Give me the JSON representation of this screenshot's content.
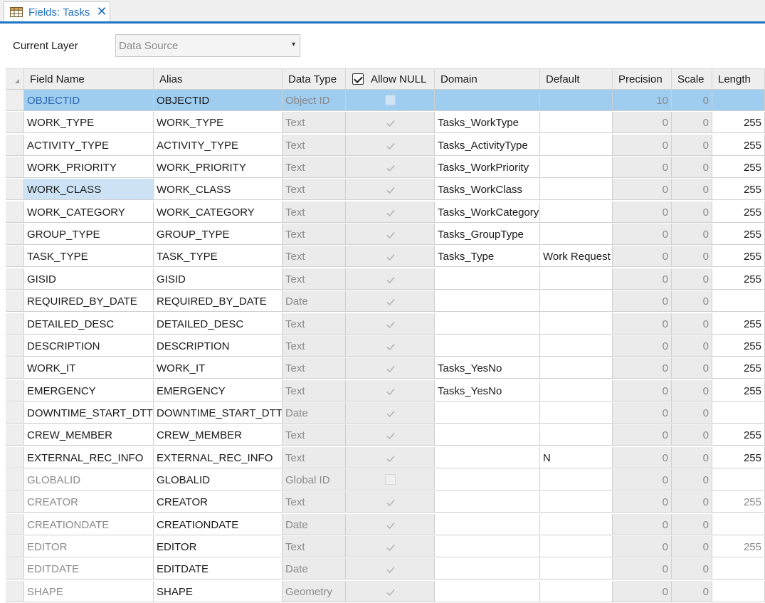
{
  "tab": {
    "title": "Fields: Tasks",
    "icon": "table-icon",
    "close_icon": "close-icon"
  },
  "layer": {
    "label": "Current Layer",
    "value": "Data Source",
    "arrow": "▾"
  },
  "columns": {
    "field_name": "Field Name",
    "alias": "Alias",
    "data_type": "Data Type",
    "allow_null": "Allow NULL",
    "domain": "Domain",
    "default": "Default",
    "precision": "Precision",
    "scale": "Scale",
    "length": "Length"
  },
  "rows": [
    {
      "field": "OBJECTID",
      "alias": "OBJECTID",
      "type": "Object ID",
      "null": "box",
      "domain": "",
      "default": "",
      "precision": "10",
      "scale": "0",
      "length": "",
      "field_style": "dim",
      "length_style": "norm"
    },
    {
      "field": "WORK_TYPE",
      "alias": "WORK_TYPE",
      "type": "Text",
      "null": "check",
      "domain": "Tasks_WorkType",
      "default": "",
      "precision": "0",
      "scale": "0",
      "length": "255",
      "field_style": "norm",
      "length_style": "norm"
    },
    {
      "field": "ACTIVITY_TYPE",
      "alias": "ACTIVITY_TYPE",
      "type": "Text",
      "null": "check",
      "domain": "Tasks_ActivityType",
      "default": "",
      "precision": "0",
      "scale": "0",
      "length": "255",
      "field_style": "norm",
      "length_style": "norm"
    },
    {
      "field": "WORK_PRIORITY",
      "alias": "WORK_PRIORITY",
      "type": "Text",
      "null": "check",
      "domain": "Tasks_WorkPriority",
      "default": "",
      "precision": "0",
      "scale": "0",
      "length": "255",
      "field_style": "norm",
      "length_style": "norm"
    },
    {
      "field": "WORK_CLASS",
      "alias": "WORK_CLASS",
      "type": "Text",
      "null": "check",
      "domain": "Tasks_WorkClass",
      "default": "",
      "precision": "0",
      "scale": "0",
      "length": "255",
      "field_style": "norm",
      "length_style": "norm"
    },
    {
      "field": "WORK_CATEGORY",
      "alias": "WORK_CATEGORY",
      "type": "Text",
      "null": "check",
      "domain": "Tasks_WorkCategory",
      "default": "",
      "precision": "0",
      "scale": "0",
      "length": "255",
      "field_style": "norm",
      "length_style": "norm"
    },
    {
      "field": "GROUP_TYPE",
      "alias": "GROUP_TYPE",
      "type": "Text",
      "null": "check",
      "domain": "Tasks_GroupType",
      "default": "",
      "precision": "0",
      "scale": "0",
      "length": "255",
      "field_style": "norm",
      "length_style": "norm"
    },
    {
      "field": "TASK_TYPE",
      "alias": "TASK_TYPE",
      "type": "Text",
      "null": "check",
      "domain": "Tasks_Type",
      "default": "Work Request",
      "precision": "0",
      "scale": "0",
      "length": "255",
      "field_style": "norm",
      "length_style": "norm"
    },
    {
      "field": "GISID",
      "alias": "GISID",
      "type": "Text",
      "null": "check",
      "domain": "",
      "default": "",
      "precision": "0",
      "scale": "0",
      "length": "255",
      "field_style": "norm",
      "length_style": "norm"
    },
    {
      "field": "REQUIRED_BY_DATE",
      "alias": "REQUIRED_BY_DATE",
      "type": "Date",
      "null": "check",
      "domain": "",
      "default": "",
      "precision": "0",
      "scale": "0",
      "length": "",
      "field_style": "norm",
      "length_style": "norm"
    },
    {
      "field": "DETAILED_DESC",
      "alias": "DETAILED_DESC",
      "type": "Text",
      "null": "check",
      "domain": "",
      "default": "",
      "precision": "0",
      "scale": "0",
      "length": "255",
      "field_style": "norm",
      "length_style": "norm"
    },
    {
      "field": "DESCRIPTION",
      "alias": "DESCRIPTION",
      "type": "Text",
      "null": "check",
      "domain": "",
      "default": "",
      "precision": "0",
      "scale": "0",
      "length": "255",
      "field_style": "norm",
      "length_style": "norm"
    },
    {
      "field": "WORK_IT",
      "alias": "WORK_IT",
      "type": "Text",
      "null": "check",
      "domain": "Tasks_YesNo",
      "default": "",
      "precision": "0",
      "scale": "0",
      "length": "255",
      "field_style": "norm",
      "length_style": "norm"
    },
    {
      "field": "EMERGENCY",
      "alias": "EMERGENCY",
      "type": "Text",
      "null": "check",
      "domain": "Tasks_YesNo",
      "default": "",
      "precision": "0",
      "scale": "0",
      "length": "255",
      "field_style": "norm",
      "length_style": "norm"
    },
    {
      "field": "DOWNTIME_START_DTTM",
      "alias": "DOWNTIME_START_DTTM",
      "type": "Date",
      "null": "check",
      "domain": "",
      "default": "",
      "precision": "0",
      "scale": "0",
      "length": "",
      "field_style": "norm",
      "length_style": "norm"
    },
    {
      "field": "CREW_MEMBER",
      "alias": "CREW_MEMBER",
      "type": "Text",
      "null": "check",
      "domain": "",
      "default": "",
      "precision": "0",
      "scale": "0",
      "length": "255",
      "field_style": "norm",
      "length_style": "norm"
    },
    {
      "field": "EXTERNAL_REC_INFO",
      "alias": "EXTERNAL_REC_INFO",
      "type": "Text",
      "null": "check",
      "domain": "",
      "default": "N",
      "precision": "0",
      "scale": "0",
      "length": "255",
      "field_style": "norm",
      "length_style": "norm"
    },
    {
      "field": "GLOBALID",
      "alias": "GLOBALID",
      "type": "Global ID",
      "null": "box",
      "domain": "",
      "default": "",
      "precision": "0",
      "scale": "0",
      "length": "",
      "field_style": "dim",
      "length_style": "norm"
    },
    {
      "field": "CREATOR",
      "alias": "CREATOR",
      "type": "Text",
      "null": "check",
      "domain": "",
      "default": "",
      "precision": "0",
      "scale": "0",
      "length": "255",
      "field_style": "dim",
      "length_style": "dim"
    },
    {
      "field": "CREATIONDATE",
      "alias": "CREATIONDATE",
      "type": "Date",
      "null": "check",
      "domain": "",
      "default": "",
      "precision": "0",
      "scale": "0",
      "length": "",
      "field_style": "dim",
      "length_style": "dim"
    },
    {
      "field": "EDITOR",
      "alias": "EDITOR",
      "type": "Text",
      "null": "check",
      "domain": "",
      "default": "",
      "precision": "0",
      "scale": "0",
      "length": "255",
      "field_style": "dim",
      "length_style": "dim"
    },
    {
      "field": "EDITDATE",
      "alias": "EDITDATE",
      "type": "Date",
      "null": "check",
      "domain": "",
      "default": "",
      "precision": "0",
      "scale": "0",
      "length": "",
      "field_style": "dim",
      "length_style": "dim"
    },
    {
      "field": "SHAPE",
      "alias": "SHAPE",
      "type": "Geometry",
      "null": "check",
      "domain": "",
      "default": "",
      "precision": "0",
      "scale": "0",
      "length": "",
      "field_style": "dim",
      "length_style": "dim"
    }
  ],
  "selected_row": 0,
  "highlighted_cell": {
    "row": 4,
    "column": "field"
  },
  "colors": {
    "accent": "#1f78c8",
    "selection": "#9fcdf0",
    "cell_highlight": "#cde3f5"
  }
}
